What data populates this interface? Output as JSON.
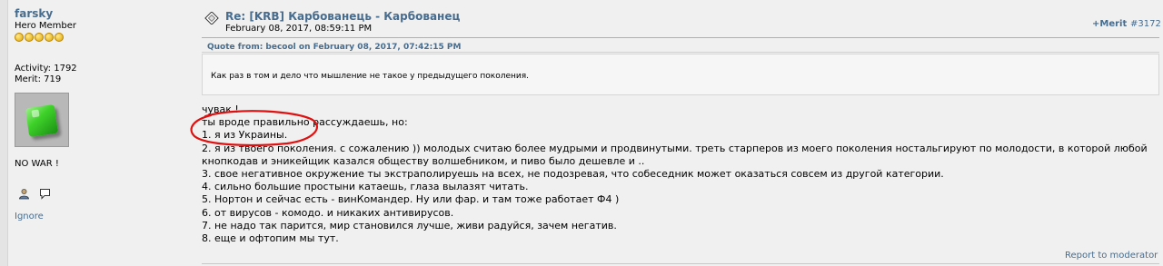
{
  "poster": {
    "username": "farsky",
    "rank": "Hero Member",
    "stars": 5,
    "activity": "Activity: 1792",
    "merit": "Merit: 719",
    "signature": "NO WAR !",
    "ignore": "Ignore"
  },
  "post": {
    "title": "Re: [KRB] Карбованець - Карбованец",
    "date": "February 08, 2017, 08:59:11 PM",
    "merit_button": "+Merit",
    "post_number": "#3172",
    "quote_header": "Quote from: becool on February 08, 2017, 07:42:15 PM",
    "quote_text": "Как раз в том и дело что мышление не такое у предыдущего поколения.",
    "lines": [
      "чувак !",
      "ты вроде правильно рассуждаешь, но:",
      "1. я из Украины.",
      "2. я из твоего поколения. с сожалению )) молодых считаю более мудрыми и продвинутыми. треть старперов из моего поколения ностальгируют по молодости, в которой любой",
      "кнопкодав и эникейщик казался обществу волшебником, и пиво было дешевле и ..",
      "3. свое негативное окружение ты экстраполируешь на всех, не подозревая, что собеседник может оказаться совсем из другой категории.",
      "4. сильно большие простыни катаешь, глаза вылазят читать.",
      "5. Нортон и сейчас есть - винКомандер. Ну или фар. и там тоже работает Ф4 )",
      "6. от вирусов - комодо. и никаких антивирусов.",
      "7. не надо так парится, мир становился лучше, живи радуйся, зачем негатив.",
      "8. еще и офтопим мы тут."
    ],
    "report": "Report to moderator"
  },
  "colors": {
    "link": "#476c8e",
    "annotation": "#e01010"
  }
}
